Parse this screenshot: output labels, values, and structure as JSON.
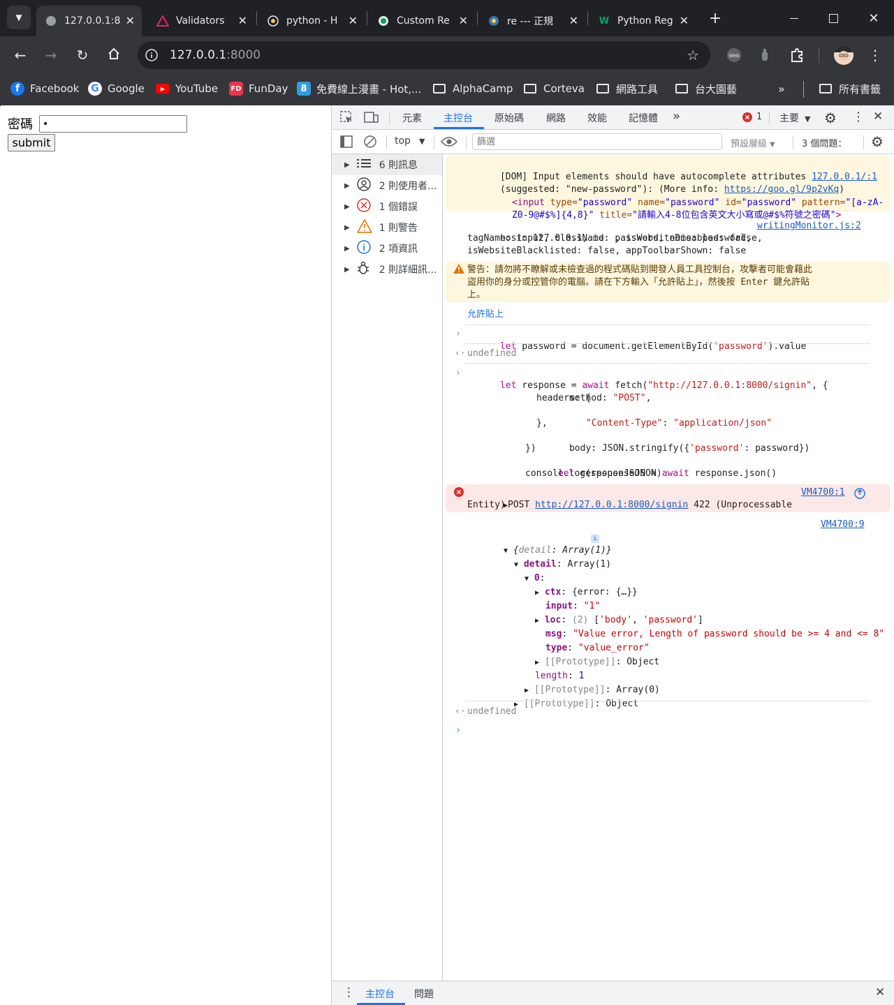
{
  "browser": {
    "tabs": [
      {
        "title": "127.0.0.1:8",
        "icon": "globe-icon",
        "active": true
      },
      {
        "title": "Validators",
        "icon": "pydantic-icon"
      },
      {
        "title": "python - H",
        "icon": "python-icon"
      },
      {
        "title": "Custom Re",
        "icon": "site-icon"
      },
      {
        "title": "re --- 正規",
        "icon": "python-icon"
      },
      {
        "title": "Python Reg",
        "icon": "w3-icon"
      }
    ],
    "url_host": "127.0.0.1",
    "url_port": ":8000",
    "bookmarks": [
      {
        "label": "Facebook"
      },
      {
        "label": "Google"
      },
      {
        "label": "YouTube"
      },
      {
        "label": "FunDay"
      },
      {
        "label": "免費線上漫畫 - Hot,..."
      },
      {
        "label": "AlphaCamp"
      },
      {
        "label": "Corteva"
      },
      {
        "label": "網路工具"
      },
      {
        "label": "台大園藝"
      }
    ],
    "all_bookmarks": "所有書籤"
  },
  "page": {
    "password_label": "密碼",
    "password_value": "•",
    "submit_label": "submit"
  },
  "devtools": {
    "tabs": [
      "元素",
      "主控台",
      "原始碼",
      "網路",
      "效能",
      "記憶體"
    ],
    "error_count": "1",
    "context_main": "主要",
    "context": "top",
    "filter_placeholder": "篩選",
    "levels": "預設層級",
    "issues": "3 個問題：",
    "sidebar": [
      {
        "label": "6 則訊息",
        "icon": "list-icon"
      },
      {
        "label": "2 則使用者...",
        "icon": "user-icon"
      },
      {
        "label": "1 個錯誤",
        "icon": "error-icon"
      },
      {
        "label": "1 則警告",
        "icon": "warning-icon"
      },
      {
        "label": "2 項資訊",
        "icon": "info-icon"
      },
      {
        "label": "2 則詳細訊...",
        "icon": "bug-icon"
      }
    ],
    "drawer_tabs": [
      "主控台",
      "問題"
    ],
    "console": {
      "dom_msg1": "[DOM] Input elements should have autocomplete attributes ",
      "dom_link1": "127.0.0.1/:1",
      "dom_msg2": "(suggested: \"new-password\"): (More info: ",
      "dom_link2": "https://goo.gl/9p2vKq",
      "dom_msg3": ")",
      "dom_tag_open": "<input",
      "dom_attr1": " type=",
      "dom_val1": "\"password\"",
      "dom_attr2": " name=",
      "dom_val2": "\"password\"",
      "dom_attr3": " id=",
      "dom_val3": "\"password\"",
      "dom_attr4": " pattern=",
      "dom_val4a": "\"[a-zA-",
      "dom_val4b": "Z0-9@#$%]{4,8}\"",
      "dom_attr5": " title=",
      "dom_val5": "\"請輸入4-8位包含英文大小寫或@#$%符號之密碼\"",
      "dom_tag_close": ">",
      "host1": "host: 127.0.0.1, id: password, name: password,",
      "host_link": "writingMonitor.js:2",
      "host2": "tagName: input, className: , isWebsiteDisabled: false,",
      "host3": "isWebsiteBlacklisted: false, appToolbarShown: false",
      "warn1": "警告：請勿將不瞭解或未檢查過的程式碼貼到開發人員工具控制台，攻擊者可能會藉此",
      "warn2": "盜用你的身分或控管你的電腦。請在下方輸入「允許貼上」，然後按 Enter 鍵允許貼",
      "warn3": "上。",
      "allow_paste": "允許貼上",
      "cmd1_kw": "let",
      "cmd1_rest": " password = document.getElementById(",
      "cmd1_str": "'password'",
      "cmd1_end": ").value",
      "undef1": "undefined",
      "cmd2_l1_kw": "let",
      "cmd2_l1_mid": " response = ",
      "cmd2_l1_kw2": "await",
      "cmd2_l1_rest": " fetch(",
      "cmd2_l1_str": "\"http://127.0.0.1:8000/signin\"",
      "cmd2_l1_end": ", {",
      "cmd2_l2_a": "method: ",
      "cmd2_l2_str": "\"POST\"",
      "cmd2_l2_end": ",",
      "cmd2_l3": "headers: {",
      "cmd2_l4_str1": "\"Content-Type\"",
      "cmd2_l4_mid": ": ",
      "cmd2_l4_str2": "\"application/json\"",
      "cmd2_l5": "},",
      "cmd2_l6_a": "body: JSON.stringify({",
      "cmd2_l6_str": "'password'",
      "cmd2_l6_end": ": password})",
      "cmd2_l7": "})",
      "cmd2_l8_kw": "let",
      "cmd2_l8_mid": " responseJSON = ",
      "cmd2_l8_kw2": "await",
      "cmd2_l8_end": " response.json()",
      "cmd2_l9": "console.log(responseJSON)",
      "err_method": "POST ",
      "err_link": "http://127.0.0.1:8000/signin",
      "err_status": " 422 (Unprocessable",
      "err_status2": "Entity)",
      "err_src": "VM4700:1",
      "log_src": "VM4700:9",
      "obj_summary_a": "{",
      "obj_summary_key": "detail",
      "obj_summary_b": ": Array(1)}",
      "detail_key": "detail",
      "detail_val": ": Array(1)",
      "idx0": "0",
      "ctx_key": "ctx",
      "ctx_val": ": {error: {…}}",
      "input_key": "input",
      "input_val": "\"1\"",
      "loc_key": "loc",
      "loc_len": "(2) ",
      "loc_val_a": "[",
      "loc_s1": "'body'",
      "loc_sep": ", ",
      "loc_s2": "'password'",
      "loc_val_b": "]",
      "msg_key": "msg",
      "msg_val": "\"Value error, Length of password should be >= 4 and <= 8\"",
      "type_key": "type",
      "type_val": "\"value_error\"",
      "proto1_key": "[[Prototype]]",
      "proto1_val": ": Object",
      "length_key": "length",
      "length_val": "1",
      "proto2_key": "[[Prototype]]",
      "proto2_val": ": Array(0)",
      "proto3_key": "[[Prototype]]",
      "proto3_val": ": Object",
      "undef2": "undefined"
    }
  },
  "colors": {
    "chrome_dark": "#202124",
    "chrome_toolbar": "#35363a",
    "devtools_accent": "#1a73e8",
    "warning_bg": "#fef7e0",
    "error_bg": "#fce8e6"
  }
}
